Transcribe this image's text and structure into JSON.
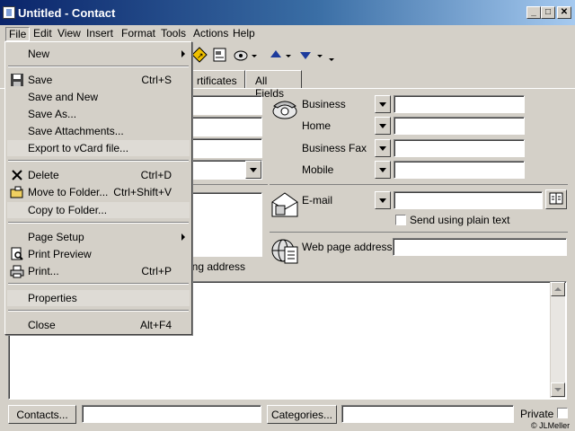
{
  "window": {
    "title": "Untitled - Contact",
    "buttons": [
      "_",
      "□",
      "✕"
    ]
  },
  "menubar": [
    {
      "label": "File",
      "key": "file"
    },
    {
      "label": "Edit",
      "key": "edit"
    },
    {
      "label": "View",
      "key": "view"
    },
    {
      "label": "Insert",
      "key": "insert"
    },
    {
      "label": "Format",
      "key": "format"
    },
    {
      "label": "Tools",
      "key": "tools"
    },
    {
      "label": "Actions",
      "key": "actions"
    },
    {
      "label": "Help",
      "key": "help"
    }
  ],
  "tabs": {
    "certificates": "rtificates",
    "all_fields": "All Fields"
  },
  "file_menu": {
    "new": "New",
    "save": "Save",
    "save_sc": "Ctrl+S",
    "save_and_new": "Save and New",
    "save_as": "Save As...",
    "save_attachments": "Save Attachments...",
    "export_vcard": "Export to vCard file...",
    "delete": "Delete",
    "delete_sc": "Ctrl+D",
    "move_to_folder": "Move to Folder...",
    "move_sc": "Ctrl+Shift+V",
    "copy_to_folder": "Copy to Folder...",
    "page_setup": "Page Setup",
    "print_preview": "Print Preview",
    "print": "Print...",
    "print_sc": "Ctrl+P",
    "properties": "Properties",
    "close": "Close",
    "close_sc": "Alt+F4"
  },
  "phones": {
    "business": "Business",
    "home": "Home",
    "business_fax": "Business Fax",
    "mobile": "Mobile"
  },
  "email": {
    "label": "E-mail",
    "plain_text": "Send using plain text"
  },
  "web": {
    "label": "Web page address:"
  },
  "address_fragment": "ing address",
  "bottom": {
    "contacts": "Contacts...",
    "categories": "Categories...",
    "private": "Private"
  },
  "copyright": "© JLMeller"
}
